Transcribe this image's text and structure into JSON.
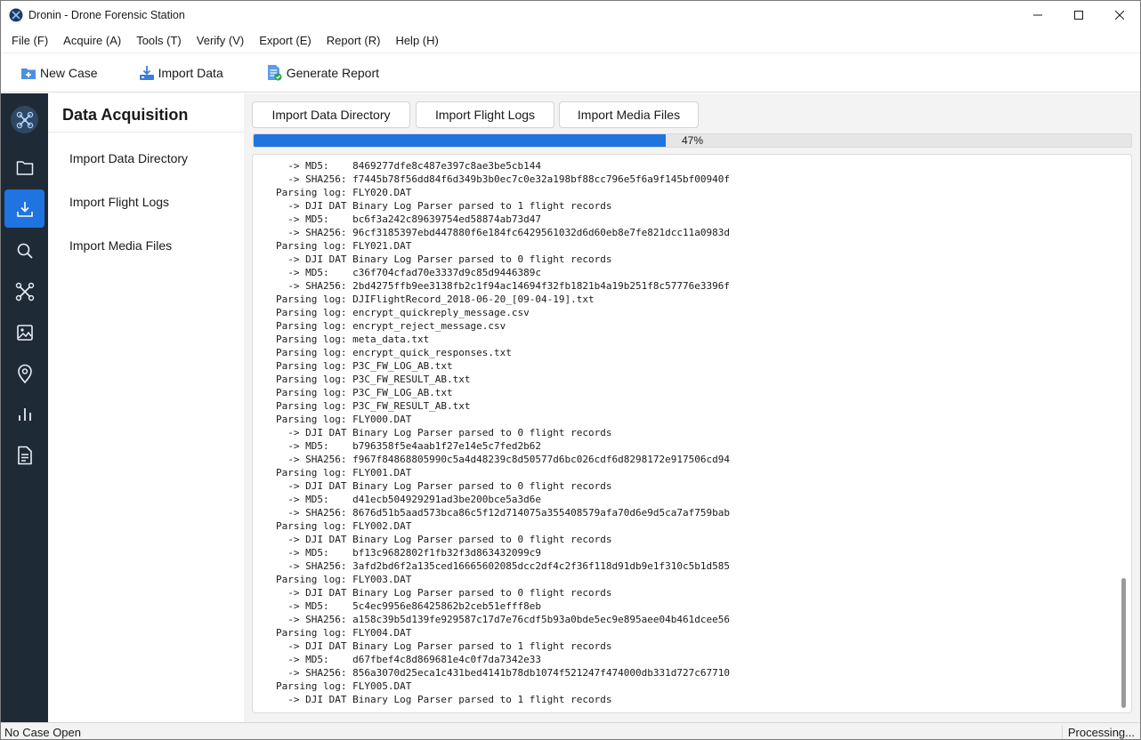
{
  "window": {
    "title": "Dronin - Drone Forensic Station"
  },
  "menu": [
    {
      "label": "File (F)"
    },
    {
      "label": "Acquire (A)"
    },
    {
      "label": "Tools (T)"
    },
    {
      "label": "Verify (V)"
    },
    {
      "label": "Export (E)"
    },
    {
      "label": "Report (R)"
    },
    {
      "label": "Help (H)"
    }
  ],
  "toolbar": {
    "new_case": "New Case",
    "import_data": "Import Data",
    "generate_report": "Generate Report"
  },
  "rail": {
    "items": [
      {
        "icon": "folder-icon"
      },
      {
        "icon": "download-icon",
        "active": true
      },
      {
        "icon": "search-icon"
      },
      {
        "icon": "drone-icon"
      },
      {
        "icon": "image-icon"
      },
      {
        "icon": "location-pin-icon"
      },
      {
        "icon": "bar-chart-icon"
      },
      {
        "icon": "document-icon"
      }
    ]
  },
  "subnav": {
    "title": "Data Acquisition",
    "items": [
      {
        "label": "Import Data Directory"
      },
      {
        "label": "Import Flight Logs"
      },
      {
        "label": "Import Media Files"
      }
    ]
  },
  "actions": {
    "import_dir": "Import Data Directory",
    "import_logs": "Import Flight Logs",
    "import_media": "Import Media Files"
  },
  "progress": {
    "value": 0.47,
    "label": "47%"
  },
  "log": [
    "  -> MD5:    8469277dfe8c487e397c8ae3be5cb144",
    "  -> SHA256: f7445b78f56dd84f6d349b3b0ec7c0e32a198bf88cc796e5f6a9f145bf00940f",
    "Parsing log: FLY020.DAT",
    "  -> DJI DAT Binary Log Parser parsed to 1 flight records",
    "  -> MD5:    bc6f3a242c89639754ed58874ab73d47",
    "  -> SHA256: 96cf3185397ebd447880f6e184fc6429561032d6d60eb8e7fe821dcc11a0983d",
    "Parsing log: FLY021.DAT",
    "  -> DJI DAT Binary Log Parser parsed to 0 flight records",
    "  -> MD5:    c36f704cfad70e3337d9c85d9446389c",
    "  -> SHA256: 2bd4275ffb9ee3138fb2c1f94ac14694f32fb1821b4a19b251f8c57776e3396f",
    "Parsing log: DJIFlightRecord_2018-06-20_[09-04-19].txt",
    "Parsing log: encrypt_quickreply_message.csv",
    "Parsing log: encrypt_reject_message.csv",
    "Parsing log: meta_data.txt",
    "Parsing log: encrypt_quick_responses.txt",
    "Parsing log: P3C_FW_LOG_AB.txt",
    "Parsing log: P3C_FW_RESULT_AB.txt",
    "Parsing log: P3C_FW_LOG_AB.txt",
    "Parsing log: P3C_FW_RESULT_AB.txt",
    "Parsing log: FLY000.DAT",
    "  -> DJI DAT Binary Log Parser parsed to 0 flight records",
    "  -> MD5:    b796358f5e4aab1f27e14e5c7fed2b62",
    "  -> SHA256: f967f84868805990c5a4d48239c8d50577d6bc026cdf6d8298172e917506cd94",
    "Parsing log: FLY001.DAT",
    "  -> DJI DAT Binary Log Parser parsed to 0 flight records",
    "  -> MD5:    d41ecb504929291ad3be200bce5a3d6e",
    "  -> SHA256: 8676d51b5aad573bca86c5f12d714075a355408579afa70d6e9d5ca7af759bab",
    "Parsing log: FLY002.DAT",
    "  -> DJI DAT Binary Log Parser parsed to 0 flight records",
    "  -> MD5:    bf13c9682802f1fb32f3d863432099c9",
    "  -> SHA256: 3afd2bd6f2a135ced16665602085dcc2df4c2f36f118d91db9e1f310c5b1d585",
    "Parsing log: FLY003.DAT",
    "  -> DJI DAT Binary Log Parser parsed to 0 flight records",
    "  -> MD5:    5c4ec9956e86425862b2ceb51efff8eb",
    "  -> SHA256: a158c39b5d139fe929587c17d7e76cdf5b93a0bde5ec9e895aee04b461dcee56",
    "Parsing log: FLY004.DAT",
    "  -> DJI DAT Binary Log Parser parsed to 1 flight records",
    "  -> MD5:    d67fbef4c8d869681e4c0f7da7342e33",
    "  -> SHA256: 856a3070d25eca1c431bed4141b78db1074f521247f474000db331d727c67710",
    "Parsing log: FLY005.DAT",
    "  -> DJI DAT Binary Log Parser parsed to 1 flight records"
  ],
  "status": {
    "left": "No Case Open",
    "right": "Processing..."
  },
  "colors": {
    "accent": "#1f74e0",
    "rail_bg": "#1f2a37"
  }
}
